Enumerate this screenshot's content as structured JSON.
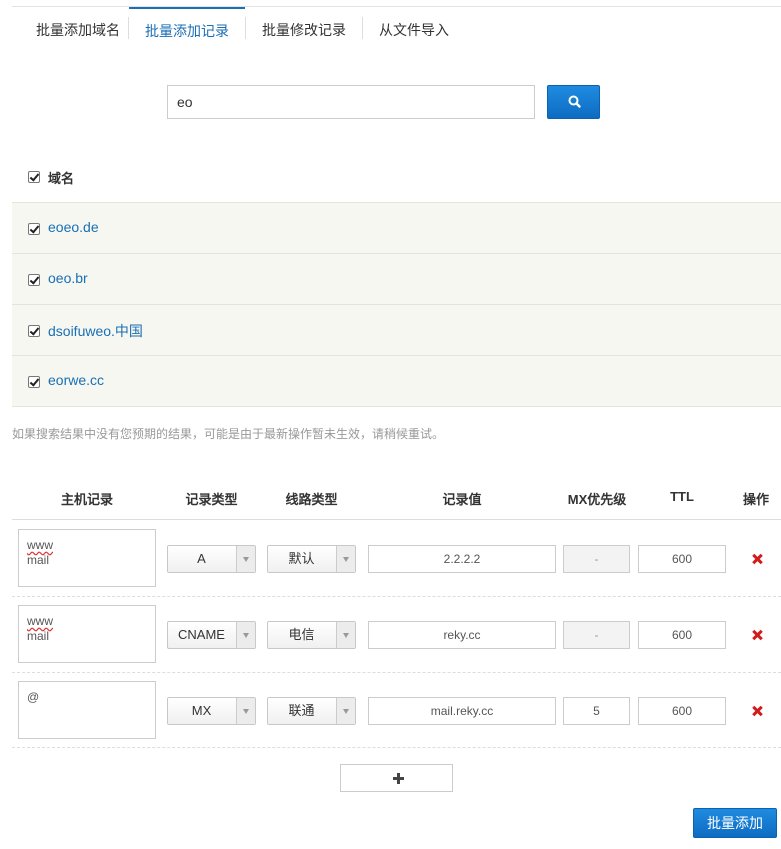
{
  "tabs": [
    {
      "label": "批量添加域名",
      "active": false
    },
    {
      "label": "批量添加记录",
      "active": true
    },
    {
      "label": "批量修改记录",
      "active": false
    },
    {
      "label": "从文件导入",
      "active": false
    }
  ],
  "search": {
    "value": "eo",
    "button_icon": "search-icon"
  },
  "domain_list": {
    "header_label": "域名",
    "header_checked": true,
    "items": [
      {
        "name": "eoeo.de",
        "checked": true
      },
      {
        "name": "oeo.br",
        "checked": true
      },
      {
        "name": "dsoifuweo.中国",
        "checked": true
      },
      {
        "name": "eorwe.cc",
        "checked": true
      }
    ]
  },
  "notice": "如果搜索结果中没有您预期的结果，可能是由于最新操作暂未生效，请稍候重试。",
  "records_table": {
    "headers": {
      "host": "主机记录",
      "type": "记录类型",
      "line": "线路类型",
      "value": "记录值",
      "mx": "MX优先级",
      "ttl": "TTL",
      "action": "操作"
    },
    "rows": [
      {
        "host_line1": "www",
        "host_line2": "mail",
        "type": "A",
        "line": "默认",
        "value": "2.2.2.2",
        "mx": "-",
        "mx_disabled": true,
        "ttl": "600"
      },
      {
        "host_line1": "www",
        "host_line2": "mail",
        "type": "CNAME",
        "line": "电信",
        "value": "reky.cc",
        "mx": "-",
        "mx_disabled": true,
        "ttl": "600"
      },
      {
        "host_line1": "@",
        "host_line2": "",
        "type": "MX",
        "line": "联通",
        "value": "mail.reky.cc",
        "mx": "5",
        "mx_disabled": false,
        "ttl": "600"
      }
    ]
  },
  "add_row_icon": "plus-icon",
  "submit_label": "批量添加",
  "colors": {
    "accent": "#1a6fb5",
    "button": "#0d6cc2",
    "delete": "#d21b1b",
    "row_bg": "#f5f7f0"
  }
}
